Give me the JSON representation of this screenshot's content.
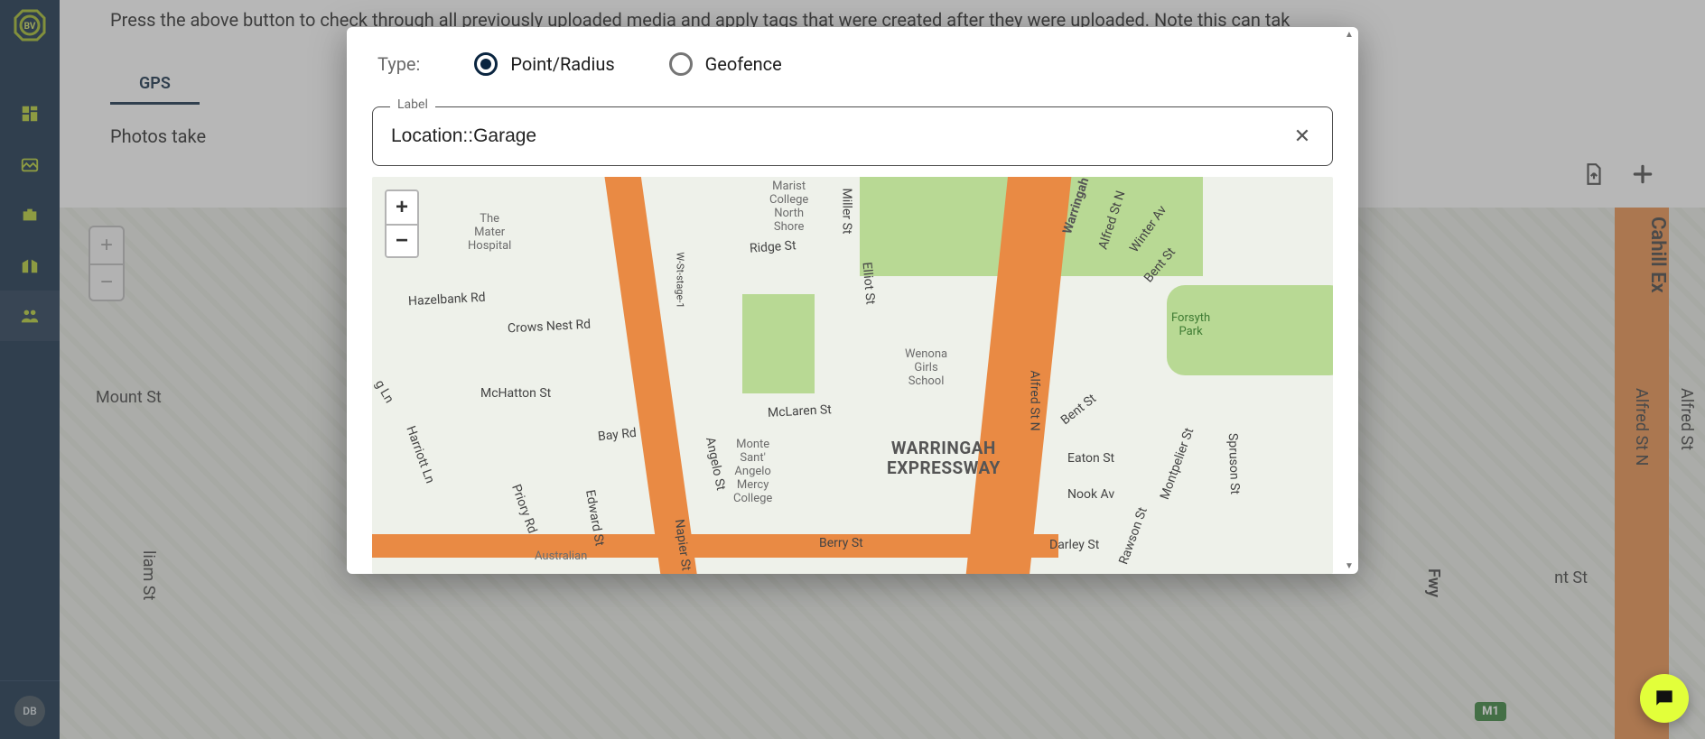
{
  "sidebar": {
    "avatar_initials": "DB"
  },
  "page": {
    "hint": "Press the above button to check through all previously uploaded media and apply tags that were created after they were uploaded. Note this can tak",
    "tab_gps": "GPS",
    "subhint": "Photos take",
    "bg_streets": {
      "mount": "Mount St",
      "liam": "liam St",
      "cahill": "Cahill Ex",
      "alfred1": "Alfred St N",
      "alfred2": "Alfred St",
      "nt": "nt St",
      "fwy": "Fwy"
    },
    "m1": "M1",
    "bg_zoom_in": "+",
    "bg_zoom_out": "−"
  },
  "dialog": {
    "type_label": "Type:",
    "opt_point": "Point/Radius",
    "opt_geo": "Geofence",
    "field_legend": "Label",
    "field_value": "Location::Garage",
    "zoom_in": "+",
    "zoom_out": "−",
    "map_places": {
      "marist": "Marist\nCollege\nNorth\nShore",
      "mater": "The\nMater\nHospital",
      "wenona": "Wenona\nGirls\nSchool",
      "monte": "Monte\nSant'\nAngelo\nMercy\nCollege",
      "forsyth": "Forsyth\nPark",
      "aus": "Australian",
      "warringah": "WARRINGAH\nEXPRESSWAY"
    },
    "map_streets": {
      "hazel": "Hazelbank Rd",
      "crows": "Crows Nest Rd",
      "ridge": "Ridge St",
      "miller": "Miller St",
      "elliot": "Elliot St",
      "mchatton": "McHatton St",
      "bay": "Bay Rd",
      "mclaren": "McLaren St",
      "berry": "Berry St",
      "angelo": "Angelo St",
      "edward": "Edward St",
      "napier": "Napier St",
      "priory": "Priory Rd",
      "harriott": "Harriott Ln",
      "gln": "g Ln",
      "wst": "W-St-stage-1",
      "winter": "Winter Av",
      "bent": "Bent St",
      "alfredn": "Alfred St N",
      "alfredsn2": "Alfred St N",
      "eaton": "Eaton St",
      "nook": "Nook Av",
      "darley": "Darley St",
      "montpelier": "Montpelier St",
      "rawson": "Rawson St",
      "spruson": "Spruson St",
      "warringah_fwy": "Warringah Fw"
    }
  }
}
